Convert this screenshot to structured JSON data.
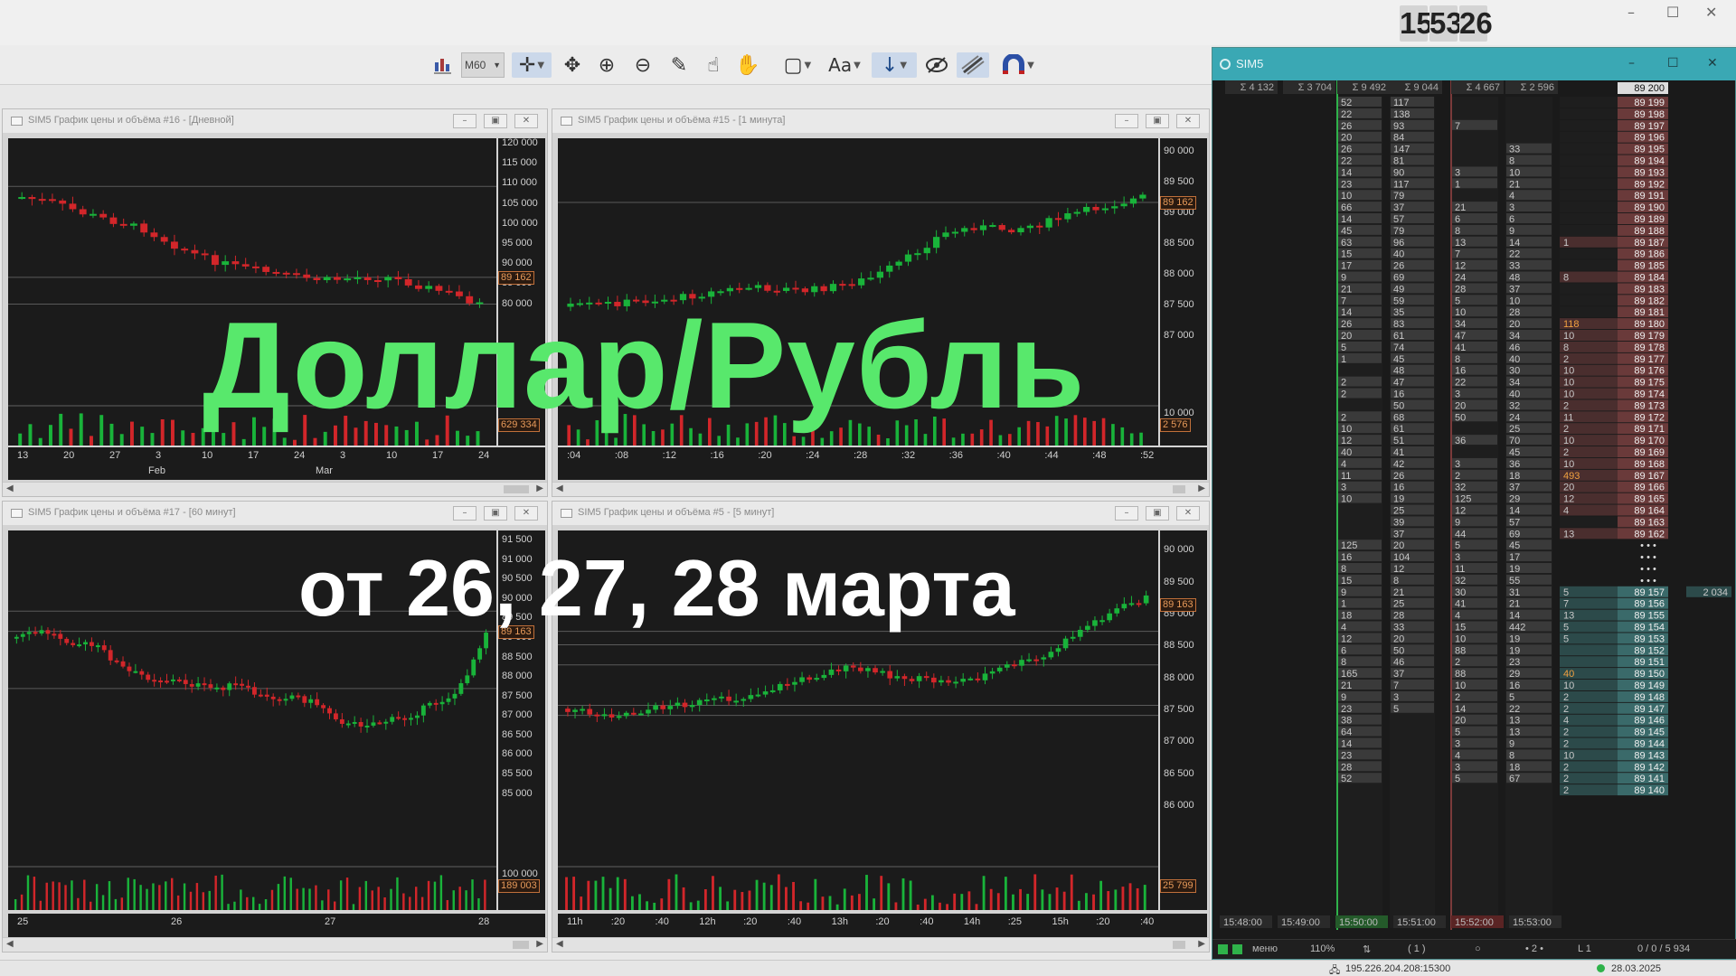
{
  "clock": [
    "15",
    "53",
    "26"
  ],
  "toolbar": {
    "timeframe": "M60",
    "text_tool": "Aa"
  },
  "windows": [
    {
      "id": "w16",
      "title": "SIM5 График цены и объёма #16 - [Дневной]",
      "y_ticks": [
        "120 000",
        "115 000",
        "110 000",
        "105 000",
        "100 000",
        "95 000",
        "90 000",
        "85 000",
        "80 000"
      ],
      "price_tag": "89 162",
      "volume_tag": "629 334",
      "x_ticks": [
        "13",
        "20",
        "27",
        "3",
        "10",
        "17",
        "24",
        "3",
        "10",
        "17",
        "24"
      ],
      "x_months": [
        "Feb",
        "Mar"
      ]
    },
    {
      "id": "w15",
      "title": "SIM5 График цены и объёма #15 - [1 минута]",
      "y_ticks": [
        "90 000",
        "89 500",
        "89 000",
        "88 500",
        "88 000",
        "87 500",
        "87 000"
      ],
      "price_tag": "89 162",
      "volume_top": "10 000",
      "volume_tag": "2 576",
      "x_ticks": [
        ":04",
        ":08",
        ":12",
        ":16",
        ":20",
        ":24",
        ":28",
        ":32",
        ":36",
        ":40",
        ":44",
        ":48",
        ":52"
      ]
    },
    {
      "id": "w17",
      "title": "SIM5 График цены и объёма #17 - [60 минут]",
      "y_ticks": [
        "91 500",
        "91 000",
        "90 500",
        "90 000",
        "89 500",
        "89 000",
        "88 500",
        "88 000",
        "87 500",
        "87 000",
        "86 500",
        "86 000",
        "85 500",
        "85 000"
      ],
      "price_tag": "89 163",
      "volume_top": "100 000",
      "volume_tag": "189 003",
      "x_ticks": [
        "25",
        "26",
        "27",
        "28"
      ]
    },
    {
      "id": "w5",
      "title": "SIM5 График цены и объёма #5 - [5 минут]",
      "y_ticks": [
        "90 000",
        "89 500",
        "89 000",
        "88 500",
        "88 000",
        "87 500",
        "87 000",
        "86 500",
        "86 000"
      ],
      "price_tag": "89 163",
      "volume_tag": "25 799",
      "x_ticks": [
        "11h",
        ":20",
        ":40",
        "12h",
        ":20",
        ":40",
        "13h",
        ":20",
        ":40",
        "14h",
        ":25",
        "15h",
        ":20",
        ":40"
      ]
    }
  ],
  "dom": {
    "title": "SIM5",
    "totals": [
      "4 132",
      "3 704",
      "9 492",
      "9 044",
      "4 667",
      "2 596"
    ],
    "top_price": "89 200",
    "asks": [
      {
        "price": "89 199",
        "c1": "52",
        "c2": "117",
        "c3": "",
        "c4": "",
        "bid": ""
      },
      {
        "price": "89 198",
        "c1": "22",
        "c2": "138",
        "c3": "",
        "c4": "",
        "bid": ""
      },
      {
        "price": "89 197",
        "c1": "26",
        "c2": "93",
        "c3": "7",
        "c4": "",
        "bid": ""
      },
      {
        "price": "89 196",
        "c1": "20",
        "c2": "84",
        "c3": "",
        "c4": "",
        "bid": ""
      },
      {
        "price": "89 195",
        "c1": "26",
        "c2": "147",
        "c3": "",
        "c4": "33",
        "bid": ""
      },
      {
        "price": "89 194",
        "c1": "22",
        "c2": "81",
        "c3": "",
        "c4": "8",
        "bid": ""
      },
      {
        "price": "89 193",
        "c1": "14",
        "c2": "90",
        "c3": "3",
        "c4": "10",
        "bid": ""
      },
      {
        "price": "89 192",
        "c1": "23",
        "c2": "117",
        "c3": "1",
        "c4": "21",
        "bid": ""
      },
      {
        "price": "89 191",
        "c1": "10",
        "c2": "79",
        "c3": "",
        "c4": "4",
        "bid": ""
      },
      {
        "price": "89 190",
        "c1": "66",
        "c2": "37",
        "c3": "21",
        "c4": "3",
        "bid": ""
      },
      {
        "price": "89 189",
        "c1": "14",
        "c2": "57",
        "c3": "6",
        "c4": "6",
        "bid": ""
      },
      {
        "price": "89 188",
        "c1": "45",
        "c2": "79",
        "c3": "8",
        "c4": "9",
        "bid": ""
      },
      {
        "price": "89 187",
        "c1": "63",
        "c2": "96",
        "c3": "13",
        "c4": "14",
        "bid": "1"
      },
      {
        "price": "89 186",
        "c1": "15",
        "c2": "40",
        "c3": "7",
        "c4": "22",
        "bid": ""
      },
      {
        "price": "89 185",
        "c1": "17",
        "c2": "26",
        "c3": "12",
        "c4": "33",
        "bid": ""
      },
      {
        "price": "89 184",
        "c1": "9",
        "c2": "69",
        "c3": "24",
        "c4": "48",
        "bid": "8"
      },
      {
        "price": "89 183",
        "c1": "21",
        "c2": "49",
        "c3": "28",
        "c4": "37",
        "bid": ""
      },
      {
        "price": "89 182",
        "c1": "7",
        "c2": "59",
        "c3": "5",
        "c4": "10",
        "bid": ""
      },
      {
        "price": "89 181",
        "c1": "14",
        "c2": "35",
        "c3": "10",
        "c4": "28",
        "bid": ""
      },
      {
        "price": "89 180",
        "c1": "26",
        "c2": "83",
        "c3": "34",
        "c4": "20",
        "bid": "118"
      },
      {
        "price": "89 179",
        "c1": "20",
        "c2": "61",
        "c3": "47",
        "c4": "34",
        "bid": "10"
      },
      {
        "price": "89 178",
        "c1": "5",
        "c2": "74",
        "c3": "41",
        "c4": "46",
        "bid": "8"
      },
      {
        "price": "89 177",
        "c1": "1",
        "c2": "45",
        "c3": "8",
        "c4": "40",
        "bid": "2"
      },
      {
        "price": "89 176",
        "c1": "",
        "c2": "48",
        "c3": "16",
        "c4": "30",
        "bid": "10"
      },
      {
        "price": "89 175",
        "c1": "2",
        "c2": "47",
        "c3": "22",
        "c4": "34",
        "bid": "10"
      },
      {
        "price": "89 174",
        "c1": "2",
        "c2": "16",
        "c3": "3",
        "c4": "40",
        "bid": "10"
      },
      {
        "price": "89 173",
        "c1": "",
        "c2": "50",
        "c3": "20",
        "c4": "32",
        "bid": "2"
      },
      {
        "price": "89 172",
        "c1": "2",
        "c2": "68",
        "c3": "50",
        "c4": "24",
        "bid": "11"
      },
      {
        "price": "89 171",
        "c1": "10",
        "c2": "61",
        "c3": "",
        "c4": "25",
        "bid": "2"
      },
      {
        "price": "89 170",
        "c1": "12",
        "c2": "51",
        "c3": "36",
        "c4": "70",
        "bid": "10"
      },
      {
        "price": "89 169",
        "c1": "40",
        "c2": "41",
        "c3": "",
        "c4": "45",
        "bid": "2"
      },
      {
        "price": "89 168",
        "c1": "4",
        "c2": "42",
        "c3": "3",
        "c4": "36",
        "bid": "10"
      },
      {
        "price": "89 167",
        "c1": "11",
        "c2": "26",
        "c3": "2",
        "c4": "18",
        "bid": "493"
      },
      {
        "price": "89 166",
        "c1": "3",
        "c2": "16",
        "c3": "32",
        "c4": "37",
        "bid": "20"
      },
      {
        "price": "89 165",
        "c1": "10",
        "c2": "19",
        "c3": "125",
        "c4": "29",
        "bid": "12"
      },
      {
        "price": "89 164",
        "c1": "",
        "c2": "25",
        "c3": "12",
        "c4": "14",
        "bid": "4"
      },
      {
        "price": "89 163",
        "c1": "",
        "c2": "39",
        "c3": "9",
        "c4": "57",
        "bid": ""
      },
      {
        "price": "89 162",
        "c1": "",
        "c2": "37",
        "c3": "44",
        "c4": "69",
        "bid": "13"
      }
    ],
    "gap_rows": [
      {
        "c1": "125",
        "c2": "20",
        "c3": "5",
        "c4": "45"
      },
      {
        "c1": "16",
        "c2": "104",
        "c3": "3",
        "c4": "17"
      },
      {
        "c1": "8",
        "c2": "12",
        "c3": "11",
        "c4": "19"
      },
      {
        "c1": "15",
        "c2": "8",
        "c3": "32",
        "c4": "55"
      }
    ],
    "ellipsis": "• • •",
    "bids": [
      {
        "price": "89 157",
        "c1": "9",
        "c2": "21",
        "c3": "30",
        "c4": "31",
        "bid": "5",
        "extra": "2 034"
      },
      {
        "price": "89 156",
        "c1": "1",
        "c2": "25",
        "c3": "41",
        "c4": "21",
        "bid": "7",
        "extra": ""
      },
      {
        "price": "89 155",
        "c1": "18",
        "c2": "28",
        "c3": "4",
        "c4": "14",
        "bid": "13",
        "extra": ""
      },
      {
        "price": "89 154",
        "c1": "4",
        "c2": "33",
        "c3": "15",
        "c4": "442",
        "bid": "5",
        "extra": ""
      },
      {
        "price": "89 153",
        "c1": "12",
        "c2": "20",
        "c3": "10",
        "c4": "19",
        "bid": "5",
        "extra": ""
      },
      {
        "price": "89 152",
        "c1": "6",
        "c2": "50",
        "c3": "88",
        "c4": "19",
        "bid": "",
        "extra": ""
      },
      {
        "price": "89 151",
        "c1": "8",
        "c2": "46",
        "c3": "2",
        "c4": "23",
        "bid": "",
        "extra": ""
      },
      {
        "price": "89 150",
        "c1": "165",
        "c2": "37",
        "c3": "88",
        "c4": "29",
        "bid": "40",
        "extra": ""
      },
      {
        "price": "89 149",
        "c1": "21",
        "c2": "7",
        "c3": "10",
        "c4": "16",
        "bid": "10",
        "extra": ""
      },
      {
        "price": "89 148",
        "c1": "9",
        "c2": "3",
        "c3": "2",
        "c4": "5",
        "bid": "2",
        "extra": ""
      },
      {
        "price": "89 147",
        "c1": "23",
        "c2": "5",
        "c3": "14",
        "c4": "22",
        "bid": "2",
        "extra": ""
      },
      {
        "price": "89 146",
        "c1": "38",
        "c2": "",
        "c3": "20",
        "c4": "13",
        "bid": "4",
        "extra": ""
      },
      {
        "price": "89 145",
        "c1": "64",
        "c2": "",
        "c3": "5",
        "c4": "13",
        "bid": "2",
        "extra": ""
      },
      {
        "price": "89 144",
        "c1": "14",
        "c2": "",
        "c3": "3",
        "c4": "9",
        "bid": "2",
        "extra": ""
      },
      {
        "price": "89 143",
        "c1": "23",
        "c2": "",
        "c3": "4",
        "c4": "8",
        "bid": "10",
        "extra": ""
      },
      {
        "price": "89 142",
        "c1": "28",
        "c2": "",
        "c3": "3",
        "c4": "18",
        "bid": "2",
        "extra": ""
      },
      {
        "price": "89 141",
        "c1": "52",
        "c2": "",
        "c3": "5",
        "c4": "67",
        "bid": "2",
        "extra": ""
      },
      {
        "price": "89 140",
        "c1": "",
        "c2": "",
        "c3": "",
        "c4": "",
        "bid": "2",
        "extra": ""
      }
    ],
    "times": [
      "15:48:00",
      "15:49:00",
      "15:50:00",
      "15:51:00",
      "15:52:00",
      "15:53:00"
    ],
    "status": [
      "меню",
      "110%",
      "⇅",
      "( 1 )",
      "○",
      "• 2 •",
      "L 1",
      "0 / 0 / 5 934"
    ]
  },
  "statusbar": {
    "server": "195.226.204.208:15300",
    "date": "28.03.2025"
  },
  "overlay": {
    "main": "Доллар/Рубль",
    "sub": "от 26, 27, 28 марта"
  }
}
